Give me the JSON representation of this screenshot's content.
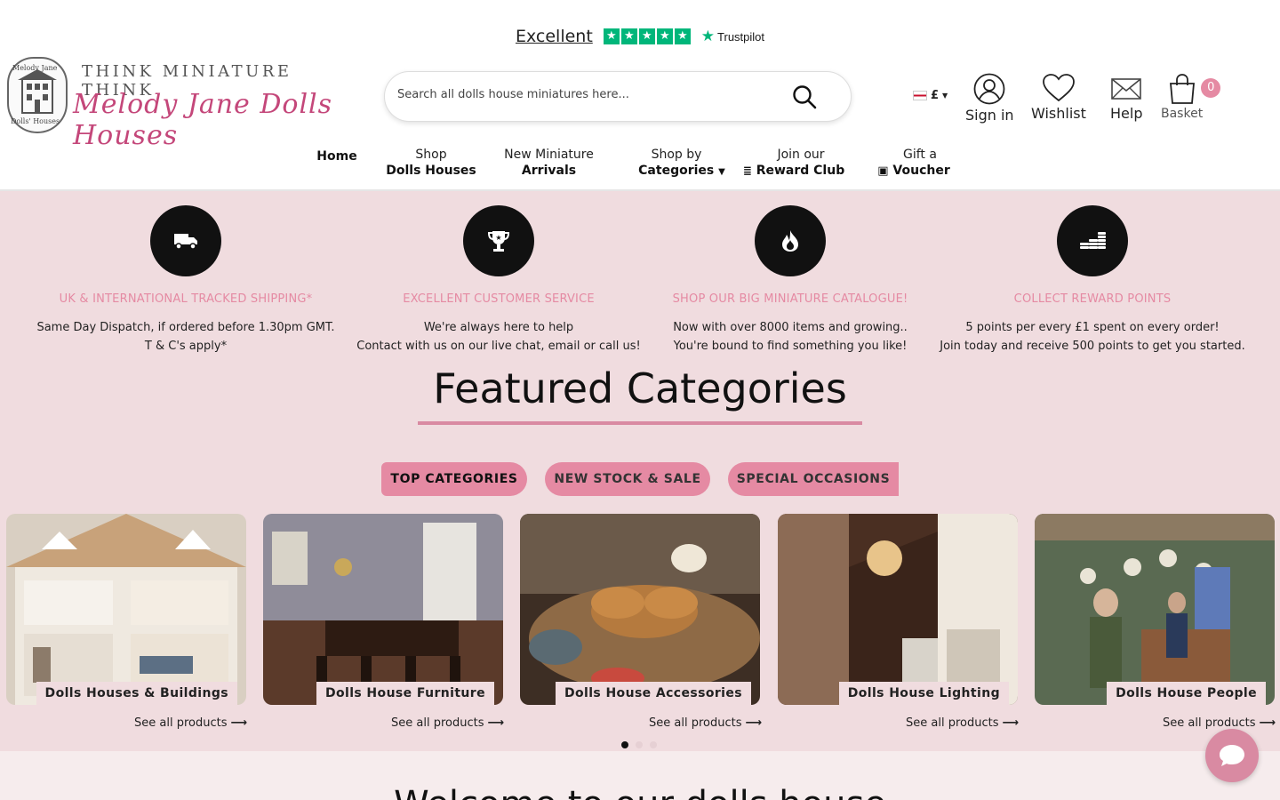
{
  "trustpilot": {
    "rating_word": "Excellent",
    "brand": "Trustpilot"
  },
  "logo": {
    "tagline": "THINK MINIATURE THINK",
    "name": "Melody Jane Dolls Houses",
    "crest_top": "Melody Jane",
    "crest_bottom": "Dolls' Houses"
  },
  "search": {
    "placeholder": "Search all dolls house miniatures here..."
  },
  "header": {
    "currency": "£",
    "sign_in": "Sign in",
    "wishlist": "Wishlist",
    "help": "Help",
    "basket": "Basket",
    "basket_count": "0"
  },
  "nav": [
    {
      "line1": "",
      "line2": "Home"
    },
    {
      "line1": "Shop",
      "line2": "Dolls Houses"
    },
    {
      "line1": "New Miniature",
      "line2": "Arrivals"
    },
    {
      "line1": "Shop by",
      "line2": "Categories"
    },
    {
      "line1": "Join our",
      "line2": "Reward Club"
    },
    {
      "line1": "Gift a",
      "line2": "Voucher"
    }
  ],
  "usps": [
    {
      "heading": "UK & INTERNATIONAL TRACKED SHIPPING*",
      "line1": "Same Day Dispatch, if ordered before 1.30pm GMT.",
      "line2": "T & C's apply*"
    },
    {
      "heading": "EXCELLENT CUSTOMER SERVICE",
      "line1": "We're always here to help",
      "line2": "Contact with us on our live chat, email or call us!"
    },
    {
      "heading": "SHOP OUR BIG MINIATURE CATALOGUE!",
      "line1": "Now with over 8000 items and growing..",
      "line2": "You're bound to find something you like!"
    },
    {
      "heading": "COLLECT REWARD POINTS",
      "line1": "5 points per every £1 spent on every order!",
      "line2": "Join today and receive 500 points to get you started."
    }
  ],
  "featured": {
    "title": "Featured Categories",
    "tabs": [
      "TOP CATEGORIES",
      "NEW STOCK & SALE",
      "SPECIAL OCCASIONS"
    ],
    "cards": [
      {
        "caption": "Dolls Houses & Buildings",
        "link": "See all products"
      },
      {
        "caption": "Dolls House Furniture",
        "link": "See all products"
      },
      {
        "caption": "Dolls House Accessories",
        "link": "See all products"
      },
      {
        "caption": "Dolls House Lighting",
        "link": "See all products"
      },
      {
        "caption": "Dolls House People",
        "link": "See all products"
      }
    ]
  },
  "welcome": {
    "heading": "Welcome to our dolls house"
  }
}
